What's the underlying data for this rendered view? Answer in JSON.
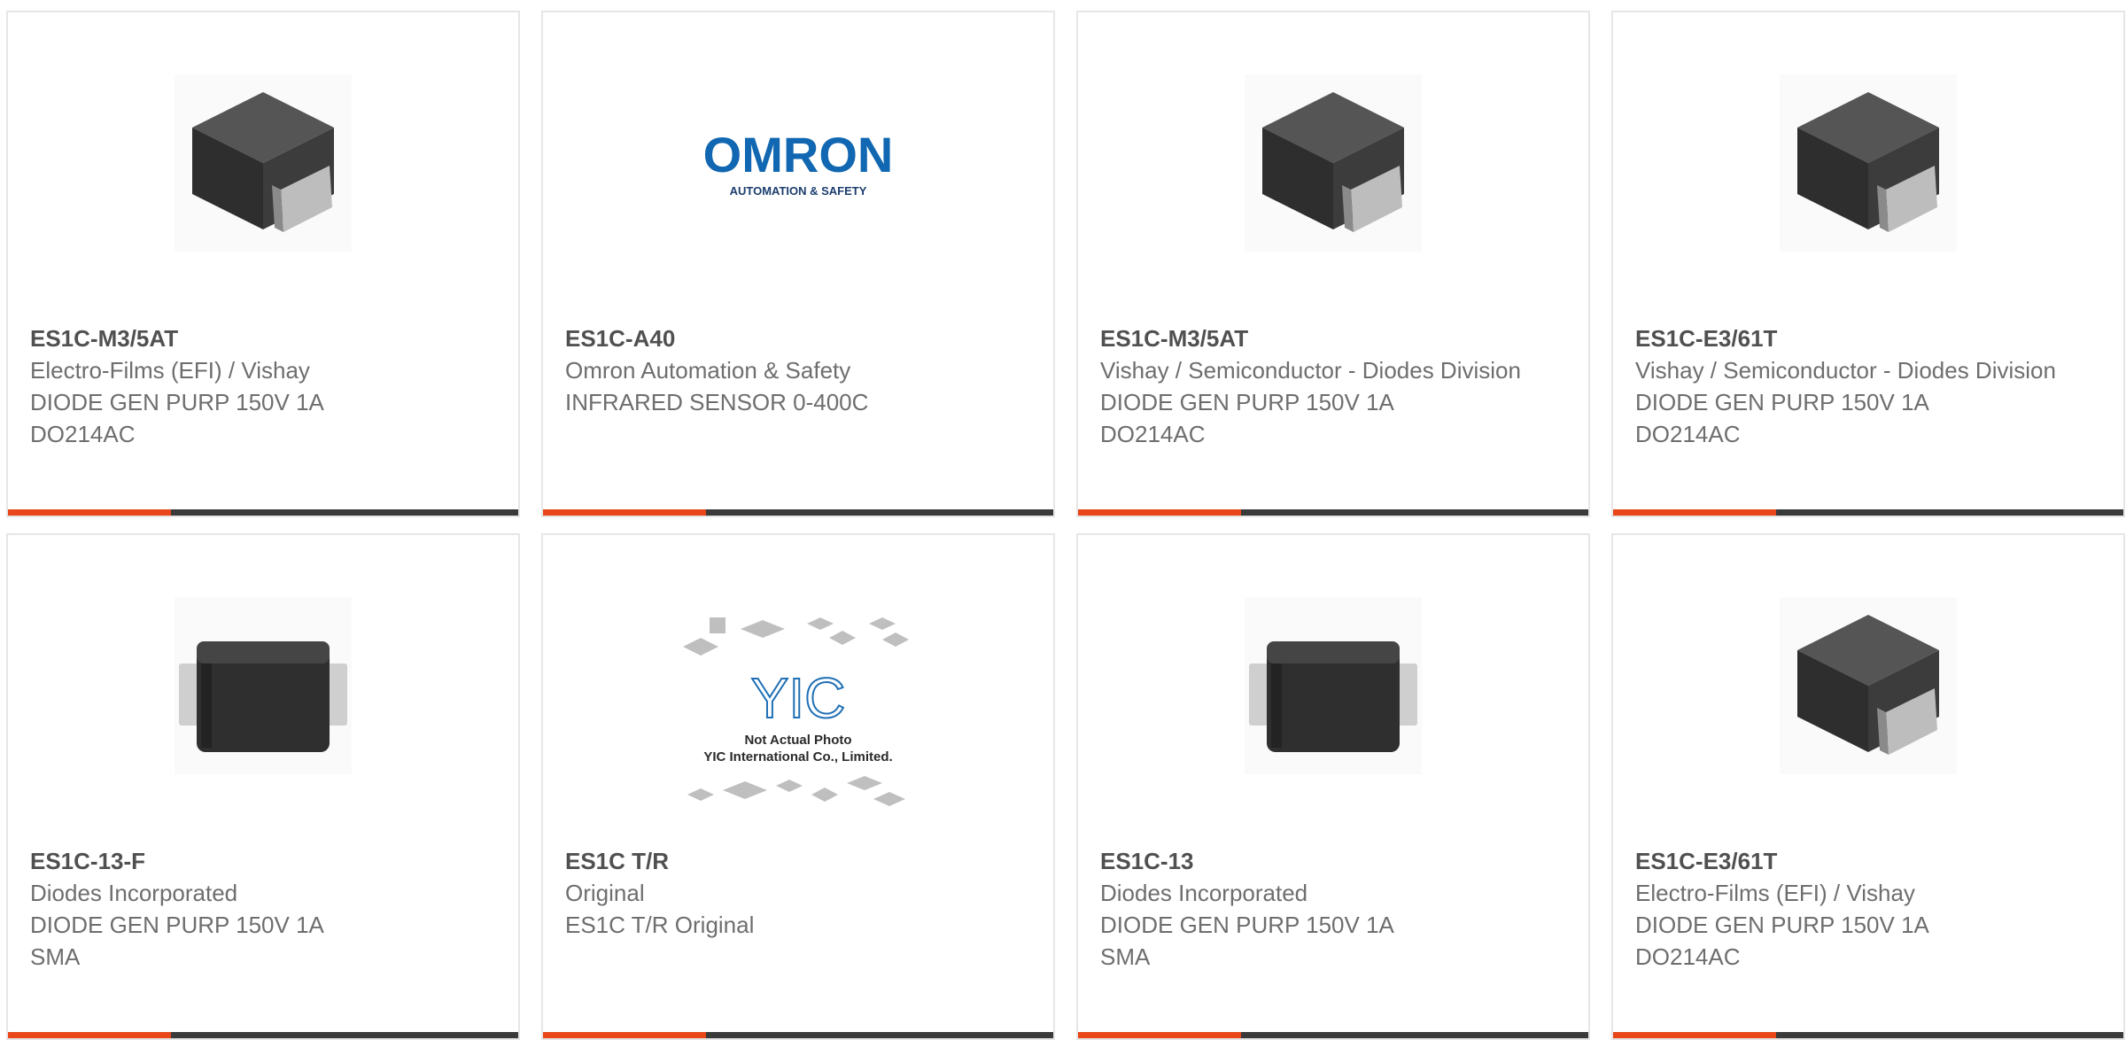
{
  "accent_color": "#e8471a",
  "bar_color": "#3a3a3a",
  "cards": [
    {
      "part": "ES1C-M3/5AT",
      "maker": "Electro-Films (EFI) / Vishay",
      "desc": "DIODE GEN PURP 150V 1A",
      "pkg": "DO214AC",
      "image": "do214ac-package"
    },
    {
      "part": "ES1C-A40",
      "maker": "Omron Automation & Safety",
      "desc": "INFRARED SENSOR 0-400C",
      "pkg": "",
      "image": "omron-logo",
      "logo_text": "OMRON",
      "logo_sub": "AUTOMATION & SAFETY"
    },
    {
      "part": "ES1C-M3/5AT",
      "maker": "Vishay / Semiconductor - Diodes Division",
      "desc": "DIODE GEN PURP 150V 1A",
      "pkg": "DO214AC",
      "image": "do214ac-package"
    },
    {
      "part": "ES1C-E3/61T",
      "maker": "Vishay / Semiconductor - Diodes Division",
      "desc": "DIODE GEN PURP 150V 1A",
      "pkg": "DO214AC",
      "image": "do214ac-package"
    },
    {
      "part": "ES1C-13-F",
      "maker": "Diodes Incorporated",
      "desc": "DIODE GEN PURP 150V 1A",
      "pkg": "SMA",
      "image": "sma-package"
    },
    {
      "part": "ES1C T/R",
      "maker": "Original",
      "desc": "ES1C T/R Original",
      "pkg": "",
      "image": "not-actual-photo",
      "logo_text": "YIC",
      "note_line1": "Not Actual Photo",
      "note_line2": "YIC International Co., Limited."
    },
    {
      "part": "ES1C-13",
      "maker": "Diodes Incorporated",
      "desc": "DIODE GEN PURP 150V 1A",
      "pkg": "SMA",
      "image": "sma-package"
    },
    {
      "part": "ES1C-E3/61T",
      "maker": "Electro-Films (EFI) / Vishay",
      "desc": "DIODE GEN PURP 150V 1A",
      "pkg": "DO214AC",
      "image": "do214ac-package"
    }
  ]
}
